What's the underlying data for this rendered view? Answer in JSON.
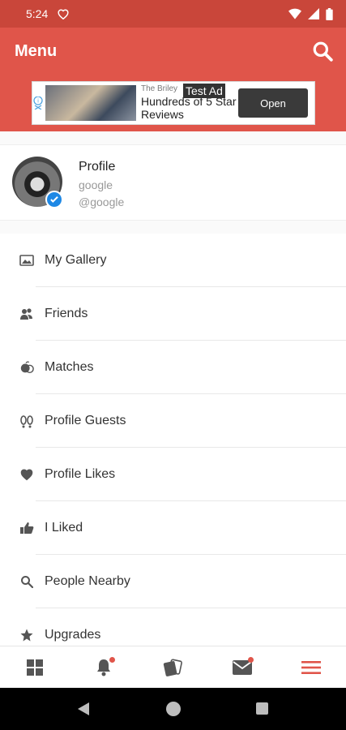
{
  "status_bar": {
    "time": "5:24"
  },
  "app_bar": {
    "title": "Menu"
  },
  "ad": {
    "brand": "The Briley",
    "tag": "Test Ad",
    "headline": "Hundreds of 5 Star Reviews",
    "button": "Open"
  },
  "profile": {
    "name": "Profile",
    "subtitle": "google",
    "handle": "@google"
  },
  "menu": {
    "items": [
      {
        "label": "My Gallery",
        "icon": "gallery-icon"
      },
      {
        "label": "Friends",
        "icon": "friends-icon"
      },
      {
        "label": "Matches",
        "icon": "matches-icon"
      },
      {
        "label": "Profile Guests",
        "icon": "footprints-icon"
      },
      {
        "label": "Profile Likes",
        "icon": "heart-icon"
      },
      {
        "label": "I Liked",
        "icon": "thumbs-up-icon"
      },
      {
        "label": "People Nearby",
        "icon": "search-icon"
      },
      {
        "label": "Upgrades",
        "icon": "star-icon"
      }
    ]
  },
  "bottom_nav": {
    "items": [
      {
        "icon": "grid-icon",
        "badge": false
      },
      {
        "icon": "bell-icon",
        "badge": true
      },
      {
        "icon": "cards-icon",
        "badge": false
      },
      {
        "icon": "mail-icon",
        "badge": true
      },
      {
        "icon": "menu-icon",
        "badge": false,
        "active": true
      }
    ]
  },
  "colors": {
    "primary": "#e0554a",
    "status_bar": "#c9463a",
    "icon_gray": "#555555",
    "verified_blue": "#1e88e5"
  }
}
